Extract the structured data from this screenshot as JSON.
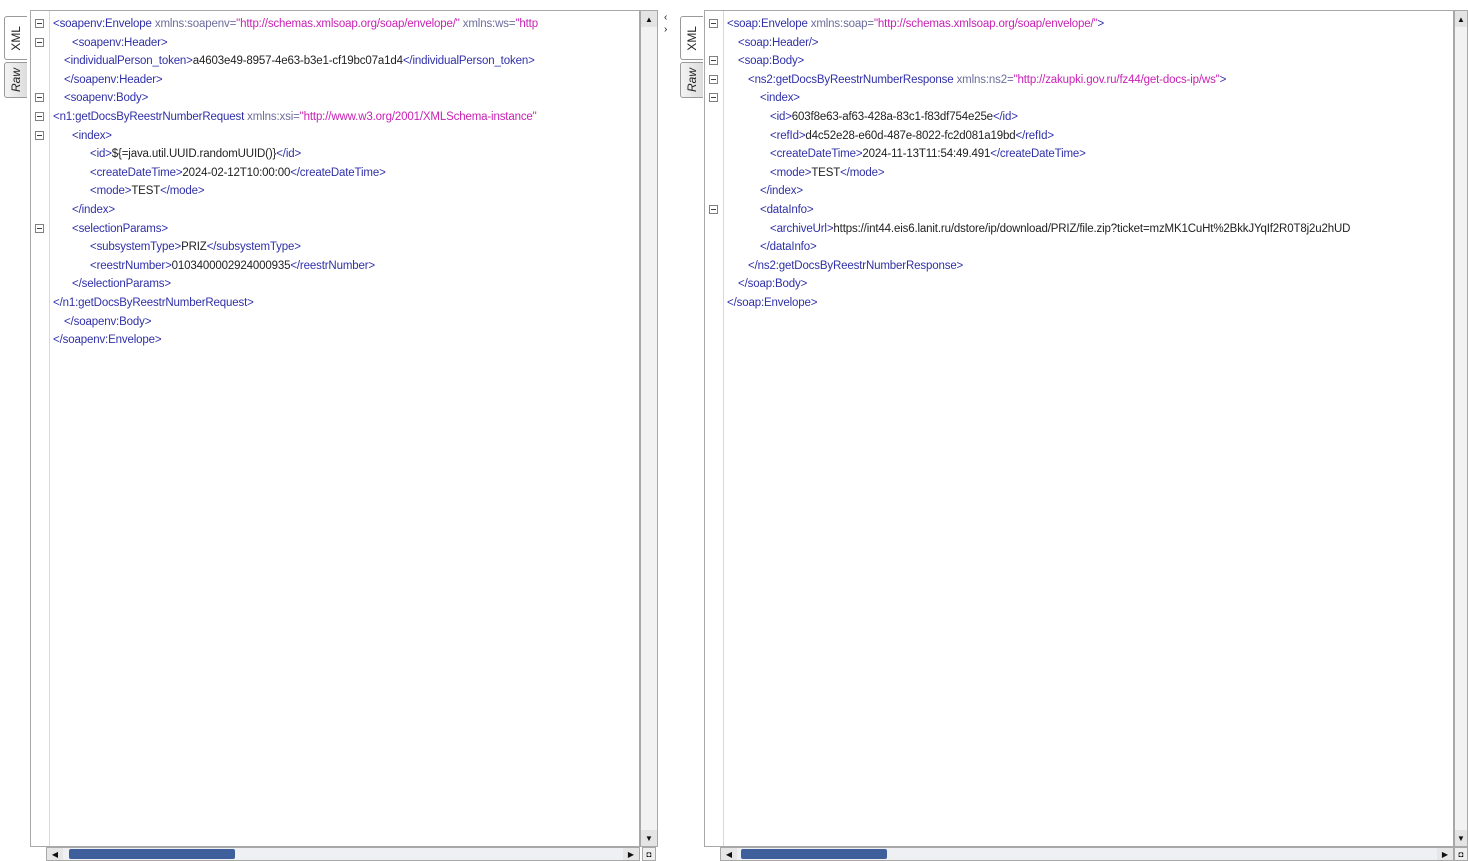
{
  "tabs": {
    "xml": "XML",
    "raw": "Raw"
  },
  "request": {
    "l0": {
      "open": "<soapenv:Envelope",
      "a1n": " xmlns:soapenv=",
      "a1v": "\"http://schemas.xmlsoap.org/soap/envelope/\"",
      "a2n": " xmlns:ws=",
      "a2v": "\"http"
    },
    "l1": {
      "tag": "<soapenv:Header>"
    },
    "l2": {
      "open": "<individualPerson_token>",
      "text": "a4603e49-8957-4e63-b3e1-cf19bc07a1d4",
      "close": "</individualPerson_token>"
    },
    "l3": {
      "tag": "</soapenv:Header>"
    },
    "l4": {
      "tag": "<soapenv:Body>"
    },
    "l5": {
      "open": "<n1:getDocsByReestrNumberRequest",
      "a1n": " xmlns:xsi=",
      "a1v": "\"http://www.w3.org/2001/XMLSchema-instance\""
    },
    "l6": {
      "tag": "<index>"
    },
    "l7": {
      "open": "<id>",
      "text": "${=java.util.UUID.randomUUID()}",
      "close": "</id>"
    },
    "l8": {
      "open": "<createDateTime>",
      "text": "2024-02-12T10:00:00",
      "close": "</createDateTime>"
    },
    "l9": {
      "open": "<mode>",
      "text": "TEST",
      "close": "</mode>"
    },
    "l10": {
      "tag": "</index>"
    },
    "l11": {
      "tag": "<selectionParams>"
    },
    "l12": {
      "open": "<subsystemType>",
      "text": "PRIZ",
      "close": "</subsystemType>"
    },
    "l13": {
      "open": "<reestrNumber>",
      "text": "0103400002924000935",
      "close": "</reestrNumber>"
    },
    "l14": {
      "tag": "</selectionParams>"
    },
    "l15": {
      "tag": "</n1:getDocsByReestrNumberRequest>"
    },
    "l16": {
      "tag": "</soapenv:Body>"
    },
    "l17": {
      "tag": "</soapenv:Envelope>"
    }
  },
  "response": {
    "l0": {
      "open": "<soap:Envelope",
      "a1n": " xmlns:soap=",
      "a1v": "\"http://schemas.xmlsoap.org/soap/envelope/\"",
      "end": ">"
    },
    "l1": {
      "tag": "<soap:Header/>"
    },
    "l2": {
      "tag": "<soap:Body>"
    },
    "l3": {
      "open": "<ns2:getDocsByReestrNumberResponse",
      "a1n": " xmlns:ns2=",
      "a1v": "\"http://zakupki.gov.ru/fz44/get-docs-ip/ws\"",
      "end": ">"
    },
    "l4": {
      "tag": "<index>"
    },
    "l5": {
      "open": "<id>",
      "text": "603f8e63-af63-428a-83c1-f83df754e25e",
      "close": "</id>"
    },
    "l6": {
      "open": "<refId>",
      "text": "d4c52e28-e60d-487e-8022-fc2d081a19bd",
      "close": "</refId>"
    },
    "l7": {
      "open": "<createDateTime>",
      "text": "2024-11-13T11:54:49.491",
      "close": "</createDateTime>"
    },
    "l8": {
      "open": "<mode>",
      "text": "TEST",
      "close": "</mode>"
    },
    "l9": {
      "tag": "</index>"
    },
    "l10": {
      "tag": "<dataInfo>"
    },
    "l11": {
      "open": "<archiveUrl>",
      "text": "https://int44.eis6.lanit.ru/dstore/ip/download/PRIZ/file.zip?ticket=mzMK1CuHt%2BkkJYqIf2R0T8j2u2hUD"
    },
    "l12": {
      "tag": "</dataInfo>"
    },
    "l13": {
      "tag": "</ns2:getDocsByReestrNumberResponse>"
    },
    "l14": {
      "tag": "</soap:Body>"
    },
    "l15": {
      "tag": "</soap:Envelope>"
    }
  }
}
